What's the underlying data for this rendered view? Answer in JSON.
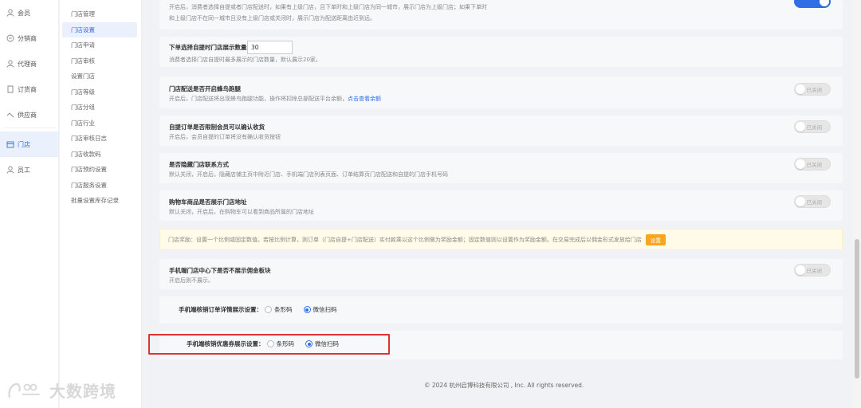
{
  "sidebar": {
    "items": [
      {
        "label": "会员",
        "icon": "user-icon"
      },
      {
        "label": "分销商",
        "icon": "share-icon"
      },
      {
        "label": "代理商",
        "icon": "agent-icon"
      },
      {
        "label": "订货商",
        "icon": "order-icon"
      },
      {
        "label": "供应商",
        "icon": "supplier-icon"
      },
      {
        "label": "门店",
        "icon": "store-icon",
        "active": true
      },
      {
        "label": "员工",
        "icon": "staff-icon"
      }
    ]
  },
  "subnav": {
    "items": [
      "门店管理",
      "门店设置",
      "门店申请",
      "门店审核",
      "设置门店",
      "门店等级",
      "门店分组",
      "门店行业",
      "门店审核日志",
      "门店收款码",
      "门店预约设置",
      "门店服务设置",
      "批量设置库存记录"
    ],
    "active_index": 1
  },
  "watermark": {
    "text": "大数跨境"
  },
  "settings": {
    "top_desc_1": "开启后，消费者选择自提或者门店配送时，如果有上级门店，且下单时和上级门店为同一城市，展示门店为上级门店；如果下单时",
    "top_desc_2": "和上级门店不在同一城市且没有上级门店或关闭时，展示门店为配送距离由近到远。",
    "count_title": "下单选择自提时门店展示数量：",
    "count_value": "30",
    "count_desc": "消费者选择门店自提时最多展示的门店数量，默认展示20家。",
    "fengniao_title": "门店配送是否开启蜂鸟跑腿",
    "fengniao_desc": "开启后，门店配送将出现蜂鸟跑腿功能，操作将扣除总部配送平台余额，",
    "fengniao_link": "点击查看余额",
    "pickup_title": "自提订单是否限制会员可以确认收货",
    "pickup_desc": "开启后，会员自提的订单将没有确认收货按钮",
    "hide_contact_title": "是否隐藏门店联系方式",
    "hide_contact_desc": "默认关闭，开启后，隐藏店铺主页中附近门店、手机端门店列表页面、订单结算页门店配送和自提的门店手机号码",
    "cart_store_title": "购物车商品是否展示门店地址",
    "cart_store_desc": "默认关闭，开启后，在购物车可以看到商品所属的门店地址",
    "notice_text": "门店奖励：设置一个比例或固定数值。若按比例计算，则订单（门店自提+门店配送）实付款乘以这个比例做为奖励金额；固定数值则以设置作为奖励金额。在交易完成后以佣金形式发放给门店",
    "notice_button": "设置",
    "commission_title": "手机端门店中心下是否不展示佣金板块",
    "commission_desc": "开启后则不展示。",
    "toggle_off_label": "已关闭",
    "order_verify_label": "手机端核销订单详情展示设置：",
    "coupon_verify_label": "手机端核销优惠券展示设置：",
    "option_barcode": "条形码",
    "option_wechat": "微信扫码"
  },
  "footer": {
    "copyright": "© 2024 杭州启博科技有限公司 , Inc. All rights reserved."
  },
  "colors": {
    "accent": "#2f6ee5",
    "warning_button": "#f5a623",
    "highlight_border": "#e03131"
  }
}
